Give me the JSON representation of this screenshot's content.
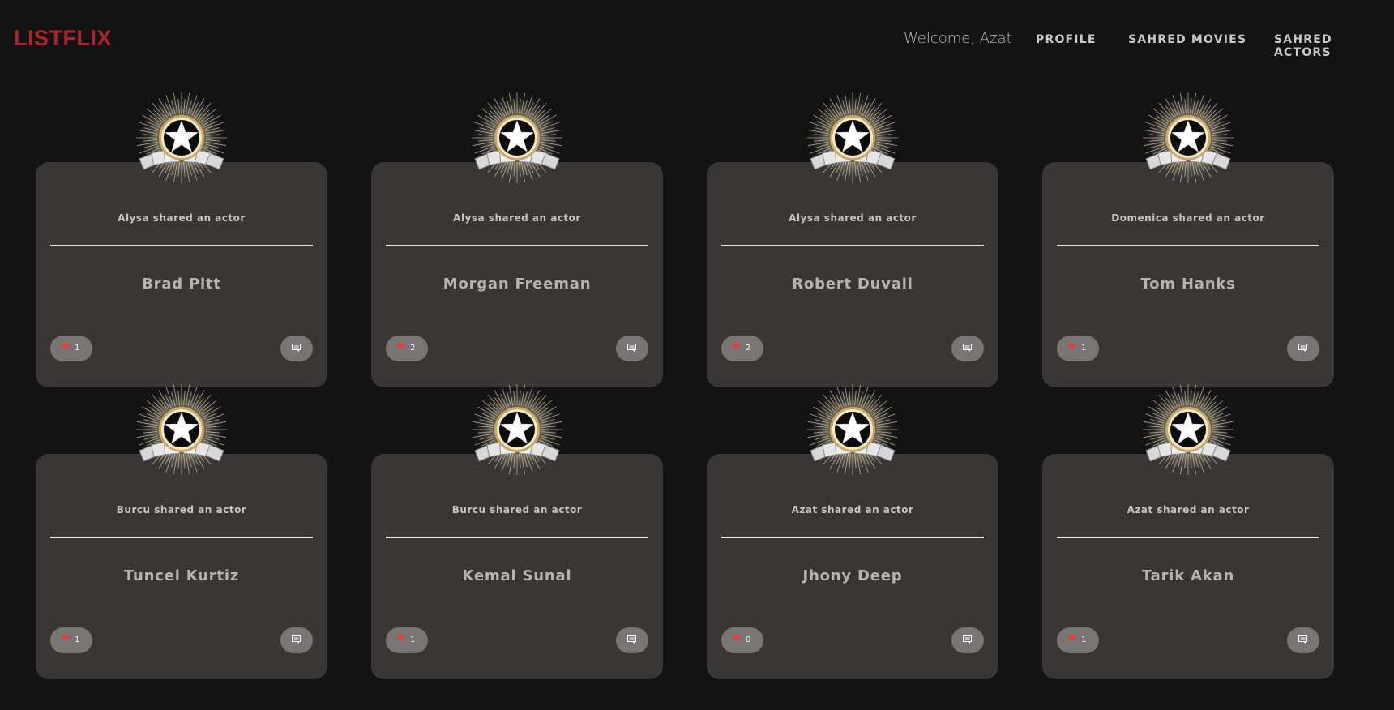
{
  "nav": {
    "logo": "LISTFLIX",
    "welcome": "Welcome, Azat",
    "links": [
      "PROFILE",
      "SAHRED MOVIES",
      "SAHRED ACTORS"
    ]
  },
  "cards": [
    {
      "caption": "Alysa shared an actor",
      "name": "Brad Pitt",
      "likes": "1"
    },
    {
      "caption": "Alysa shared an actor",
      "name": "Morgan Freeman",
      "likes": "2"
    },
    {
      "caption": "Alysa shared an actor",
      "name": "Robert Duvall",
      "likes": "2"
    },
    {
      "caption": "Domenica shared an actor",
      "name": "Tom Hanks",
      "likes": "1"
    },
    {
      "caption": "Burcu shared an actor",
      "name": "Tuncel Kurtiz",
      "likes": "1"
    },
    {
      "caption": "Burcu shared an actor",
      "name": "Kemal Sunal",
      "likes": "1"
    },
    {
      "caption": "Azat shared an actor",
      "name": "Jhony Deep",
      "likes": "0"
    },
    {
      "caption": "Azat shared an actor",
      "name": "Tarik Akan",
      "likes": "1"
    }
  ],
  "icons": {
    "badge": "star-award-badge-icon",
    "like": "heart-icon",
    "comment": "comment-icon"
  },
  "colors": {
    "background": "#141314",
    "card": "#3a3635",
    "logo": "#a8262b",
    "heart": "#e93c3c",
    "pill": "#787574"
  }
}
